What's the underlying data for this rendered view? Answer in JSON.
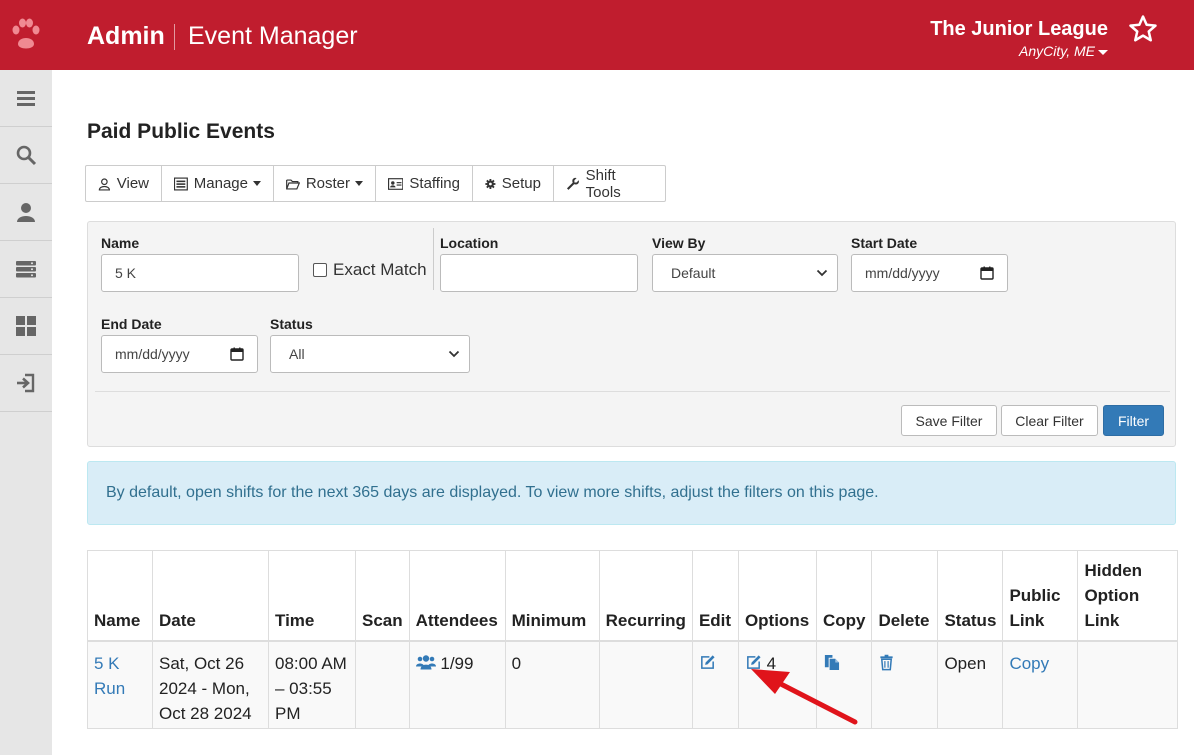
{
  "header": {
    "brand": "Admin",
    "app_title": "Event Manager",
    "org_name": "The Junior League",
    "org_city": "AnyCity, ME"
  },
  "sidebar": {
    "items": [
      {
        "icon": "menu-icon"
      },
      {
        "icon": "search-icon"
      },
      {
        "icon": "user-icon"
      },
      {
        "icon": "server-icon"
      },
      {
        "icon": "dashboard-icon"
      },
      {
        "icon": "sign-in-icon"
      }
    ]
  },
  "page": {
    "title": "Paid Public Events"
  },
  "toolbar": {
    "view": "View",
    "manage": "Manage",
    "roster": "Roster",
    "staffing": "Staffing",
    "setup": "Setup",
    "shift_tools": "Shift Tools"
  },
  "filters": {
    "name_label": "Name",
    "name_value": "5 K",
    "exact_match_label": "Exact Match",
    "location_label": "Location",
    "location_value": "",
    "view_by_label": "View By",
    "view_by_value": "Default",
    "start_date_label": "Start Date",
    "start_date_placeholder": "mm/dd/yyyy",
    "end_date_label": "End Date",
    "end_date_placeholder": "mm/dd/yyyy",
    "status_label": "Status",
    "status_value": "All",
    "save_filter": "Save Filter",
    "clear_filter": "Clear Filter",
    "filter": "Filter"
  },
  "info_message": "By default, open shifts for the next 365 days are displayed. To view more shifts, adjust the filters on this page.",
  "table": {
    "headers": {
      "name": "Name",
      "date": "Date",
      "time": "Time",
      "scan": "Scan",
      "attendees": "Attendees",
      "minimum": "Minimum",
      "recurring": "Recurring",
      "edit": "Edit",
      "options": "Options",
      "copy": "Copy",
      "delete": "Delete",
      "status": "Status",
      "public_link_1": "Public",
      "public_link_2": "Link",
      "hidden_1": "Hidden",
      "hidden_2": "Option",
      "hidden_3": "Link"
    },
    "rows": [
      {
        "name_1": "5 K",
        "name_2": "Run",
        "date_1": "Sat, Oct 26",
        "date_2": "2024 - Mon,",
        "date_3": "Oct 28 2024",
        "time_1": "08:00 AM",
        "time_2": "– 03:55",
        "time_3": "PM",
        "attendees": "1/99",
        "minimum": "0",
        "options_count": "4",
        "status": "Open",
        "public_link": "Copy"
      }
    ]
  },
  "colors": {
    "header_bg": "#c01d2e",
    "link": "#337ab7",
    "primary_button": "#337ab7",
    "info_bg": "#d9edf7",
    "arrow": "#e0141b"
  }
}
